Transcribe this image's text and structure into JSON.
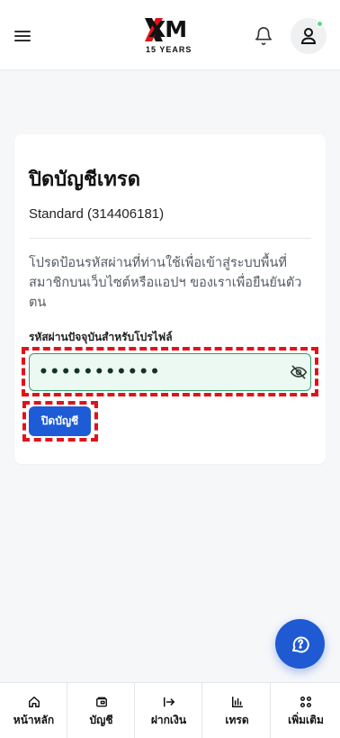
{
  "header": {
    "logo_main": "XM",
    "logo_sub": "15 YEARS",
    "has_notification_dot": true
  },
  "colors": {
    "primary": "#1e5bd6",
    "brand_red": "#e1131a",
    "input_bg": "#ecf8f2",
    "input_border": "#2f9e6a",
    "status_dot": "#5ad88a"
  },
  "card": {
    "title": "ปิดบัญชีเทรด",
    "account": "Standard (314406181)",
    "instructions": "โปรดป้อนรหัสผ่านที่ท่านใช้เพื่อเข้าสู่ระบบพื้นที่สมาชิกบนเว็บไซต์หรือแอปฯ ของเราเพื่อยืนยันตัวตน",
    "password_label": "รหัสผ่านปัจจุบันสำหรับโปรไฟล์",
    "password_value": "•••••••••••",
    "close_button_label": "ปิดบัญชี"
  },
  "icons": {
    "menu": "menu-icon",
    "bell": "bell-icon",
    "user": "user-icon",
    "eye_off": "eye-off-icon",
    "chat": "chat-help-icon"
  },
  "bottom_nav": [
    {
      "label": "หน้าหลัก",
      "icon": "home-icon"
    },
    {
      "label": "บัญชี",
      "icon": "wallet-icon"
    },
    {
      "label": "ฝากเงิน",
      "icon": "deposit-arrow-icon"
    },
    {
      "label": "เทรด",
      "icon": "chart-icon"
    },
    {
      "label": "เพิ่มเติม",
      "icon": "more-grid-icon"
    }
  ]
}
